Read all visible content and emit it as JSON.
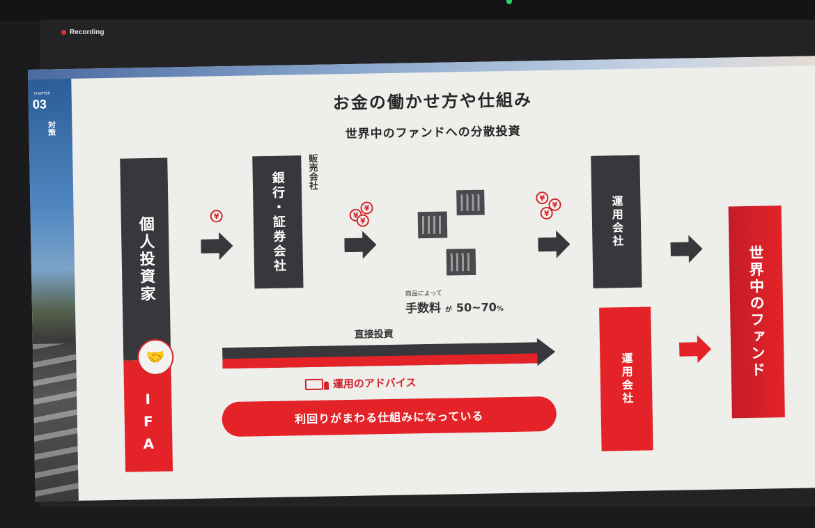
{
  "window": {
    "recording_label": "Recording"
  },
  "slide": {
    "chapter_label": "CHAPTER",
    "chapter_number": "03",
    "chapter_subtitle": "対策",
    "title": "お金の働かせ方や仕組み",
    "subtitle": "世界中のファンドへの分散投資",
    "individual_investor": "個人投資家",
    "ifa": "IFA",
    "bank_securities": "銀行・証券会社",
    "sales_company": "販売会社",
    "asset_manager_top": "運用会社",
    "asset_manager_bottom": "運用会社",
    "world_funds": "世界中のファンド",
    "fee_small": "商品によって",
    "fee_main": "手数料",
    "fee_ga": "が",
    "fee_percent": "50~70",
    "fee_unit": "%",
    "direct_investment": "直接投資",
    "advice": "運用のアドバイス",
    "pill_text": "利回りがまわる仕組みになっている",
    "yen_symbol": "¥"
  },
  "colors": {
    "red": "#e32328",
    "dark": "#38383c",
    "background": "#eeeeeb"
  }
}
